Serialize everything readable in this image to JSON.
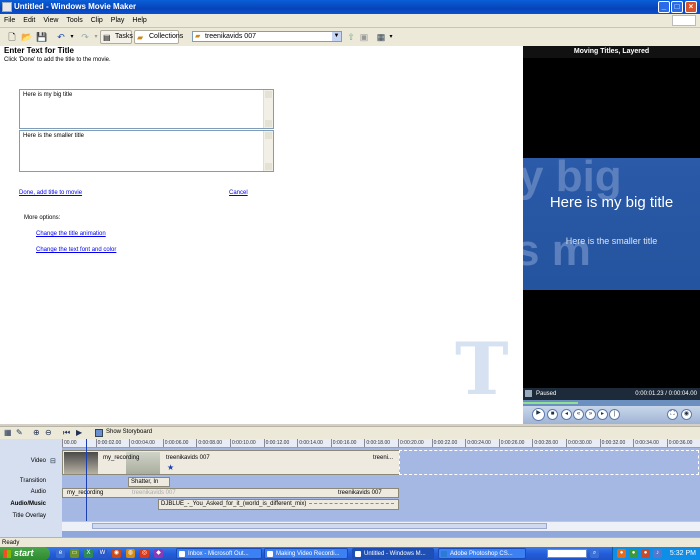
{
  "window": {
    "title": "Untitled - Windows Movie Maker"
  },
  "menu": [
    "File",
    "Edit",
    "View",
    "Tools",
    "Clip",
    "Play",
    "Help"
  ],
  "toolbar": {
    "tasks_label": "Tasks",
    "collections_label": "Collections",
    "collection_value": "treenikavids 007"
  },
  "panel": {
    "heading": "Enter Text for Title",
    "instruction": "Click 'Done' to add the title to the movie.",
    "main_title_text": "Here is my big title",
    "sub_title_text": "Here is the smaller title",
    "done_link": "Done, add title to movie",
    "cancel_link": "Cancel",
    "more_options_label": "More options:",
    "option_animation": "Change the title animation",
    "option_font": "Change the text font and color"
  },
  "preview": {
    "title": "Moving Titles, Layered",
    "big_text": "Here is my big title",
    "small_text": "Here is the smaller title",
    "status": "Paused",
    "time": "0:00:01.23 / 0:00:04.00",
    "progress": 0.31
  },
  "timeline": {
    "storyboard_label": "Show Storyboard",
    "track_labels": {
      "video": "Video",
      "transition": "Transition",
      "audio": "Audio",
      "audio_music": "Audio/Music",
      "title_overlay": "Title Overlay"
    },
    "ticks": [
      "00.00",
      "0:00:02.00",
      "0:00:04.00",
      "0:00:06.00",
      "0:00:08.00",
      "0:00:10.00",
      "0:00:12.00",
      "0:00:14.00",
      "0:00:16.00",
      "0:00:18.00",
      "0:00:20.00",
      "0:00:22.00",
      "0:00:24.00",
      "0:00:26.00",
      "0:00:28.00",
      "0:00:30.00",
      "0:00:32.00",
      "0:00:34.00",
      "0:00:36.00"
    ],
    "video_clips": [
      "my_recording",
      "treenikavids 007",
      "treeni..."
    ],
    "transition": "Shatter, In",
    "audio_clips": [
      "my_recording",
      "treenikavids 007",
      "treenikavids 007"
    ],
    "music_clip": "DJBLUE_-_You_Asked_for_it_(world_is_different_mix)"
  },
  "status_bar": {
    "text": "Ready"
  },
  "taskbar": {
    "start_label": "start",
    "tasks": [
      "Inbox - Microsoft Out...",
      "Making Video Recordi...",
      "Untitled - Windows M...",
      "Adobe Photoshop CS..."
    ],
    "clock": "5:32 PM"
  }
}
